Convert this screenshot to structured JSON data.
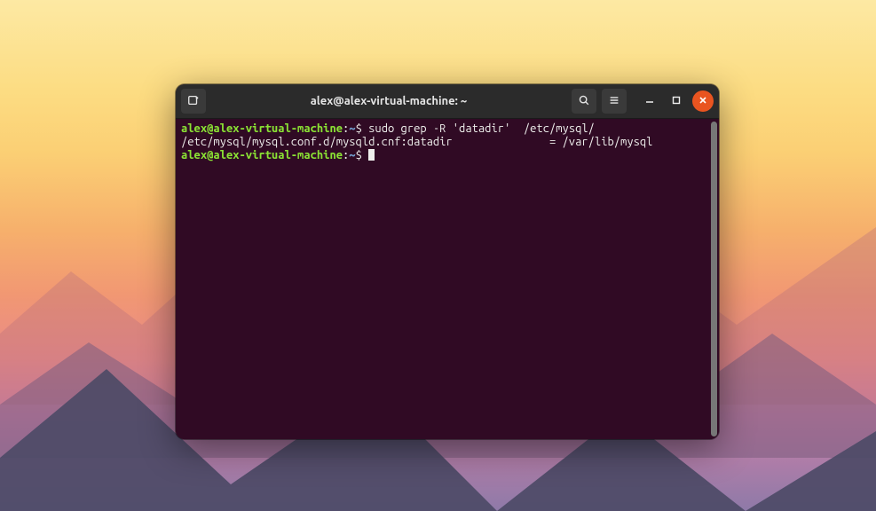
{
  "window": {
    "title": "alex@alex-virtual-machine: ~"
  },
  "prompt": {
    "user": "alex",
    "at": "@",
    "host": "alex-virtual-machine",
    "colon": ":",
    "path": "~",
    "dollar": "$"
  },
  "lines": {
    "cmd1": " sudo grep -R 'datadir'  /etc/mysql/",
    "out1": "/etc/mysql/mysql.conf.d/mysqld.cnf:datadir               = /var/lib/mysql",
    "cmd2": " "
  },
  "icons": {
    "newtab": "new-tab-icon",
    "search": "search-icon",
    "menu": "hamburger-menu-icon",
    "min": "minimize-icon",
    "max": "maximize-icon",
    "close": "close-icon"
  }
}
